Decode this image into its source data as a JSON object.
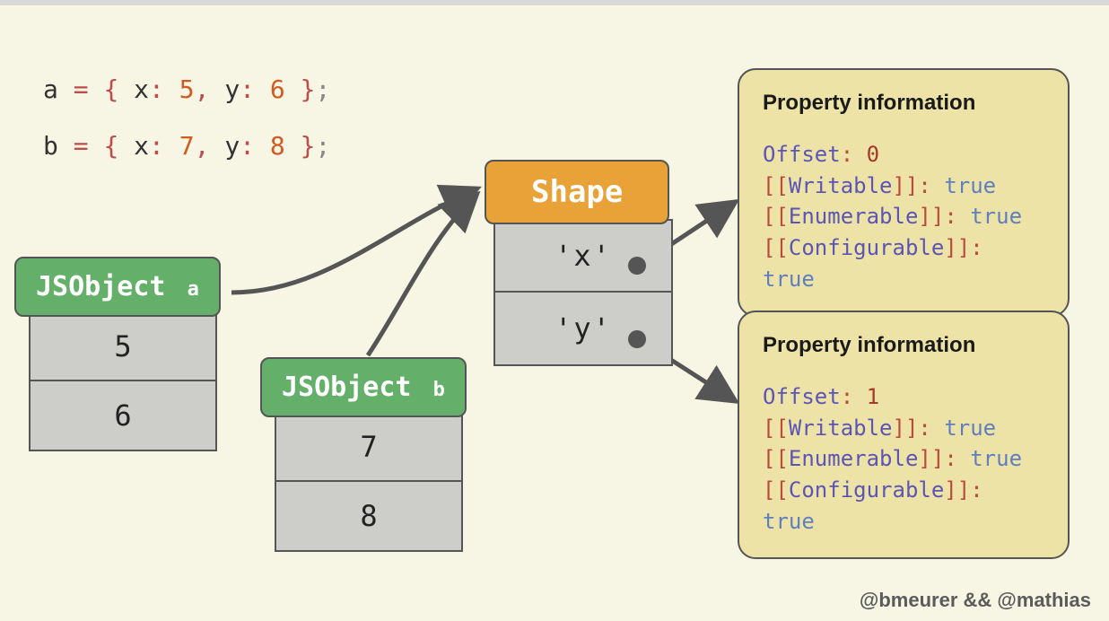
{
  "code": {
    "line1": {
      "v": "a",
      "eq": "=",
      "lb": "{",
      "k1": "x",
      "c1": ":",
      "n1": "5",
      "cm1": ",",
      "k2": "y",
      "c2": ":",
      "n2": "6",
      "rb": "}",
      "sc": ";"
    },
    "line2": {
      "v": "b",
      "eq": "=",
      "lb": "{",
      "k1": "x",
      "c1": ":",
      "n1": "7",
      "cm1": ",",
      "k2": "y",
      "c2": ":",
      "n2": "8",
      "rb": "}",
      "sc": ";"
    }
  },
  "jsobject_a": {
    "label": "JSObject",
    "suffix": "a",
    "values": [
      "5",
      "6"
    ]
  },
  "jsobject_b": {
    "label": "JSObject",
    "suffix": "b",
    "values": [
      "7",
      "8"
    ]
  },
  "shape": {
    "label": "Shape",
    "props": [
      "'x'",
      "'y'"
    ]
  },
  "propinfo1": {
    "title": "Property information",
    "offset_key": "Offset",
    "offset_val": "0",
    "writable_key": "Writable",
    "writable_val": "true",
    "enumerable_key": "Enumerable",
    "enumerable_val": "true",
    "configurable_key": "Configurable",
    "configurable_val": "true"
  },
  "propinfo2": {
    "title": "Property information",
    "offset_key": "Offset",
    "offset_val": "1",
    "writable_key": "Writable",
    "writable_val": "true",
    "enumerable_key": "Enumerable",
    "enumerable_val": "true",
    "configurable_key": "Configurable",
    "configurable_val": "true"
  },
  "credit": "@bmeurer && @mathias"
}
